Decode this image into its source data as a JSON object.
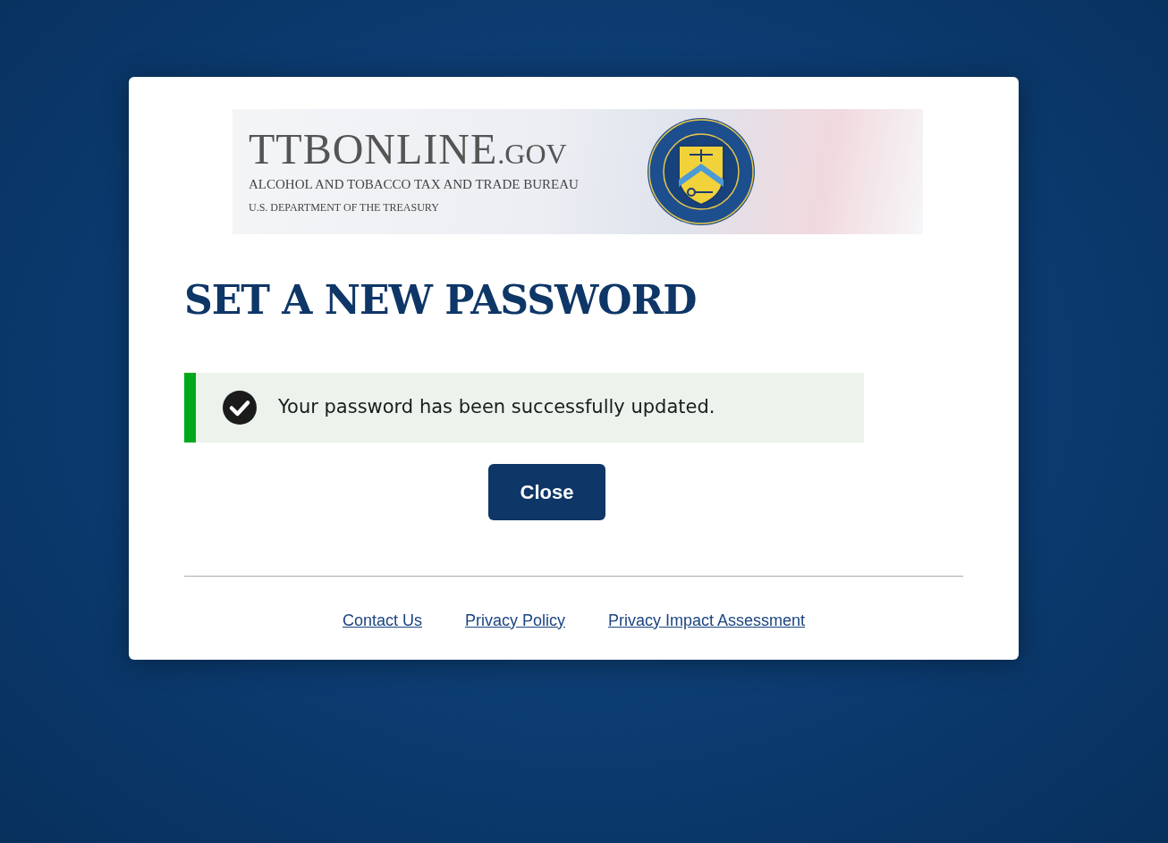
{
  "banner": {
    "brand": "TTBONLINE",
    "brand_suffix": ".GOV",
    "agency": "ALCOHOL AND TOBACCO TAX AND TRADE BUREAU",
    "department": "U.S. DEPARTMENT OF THE TREASURY"
  },
  "heading": "SET A NEW PASSWORD",
  "alert": {
    "kind": "success",
    "message": "Your password has been successfully updated."
  },
  "close_button": "Close",
  "footer_links": [
    "Contact Us",
    "Privacy Policy",
    "Privacy Impact Assessment"
  ]
}
